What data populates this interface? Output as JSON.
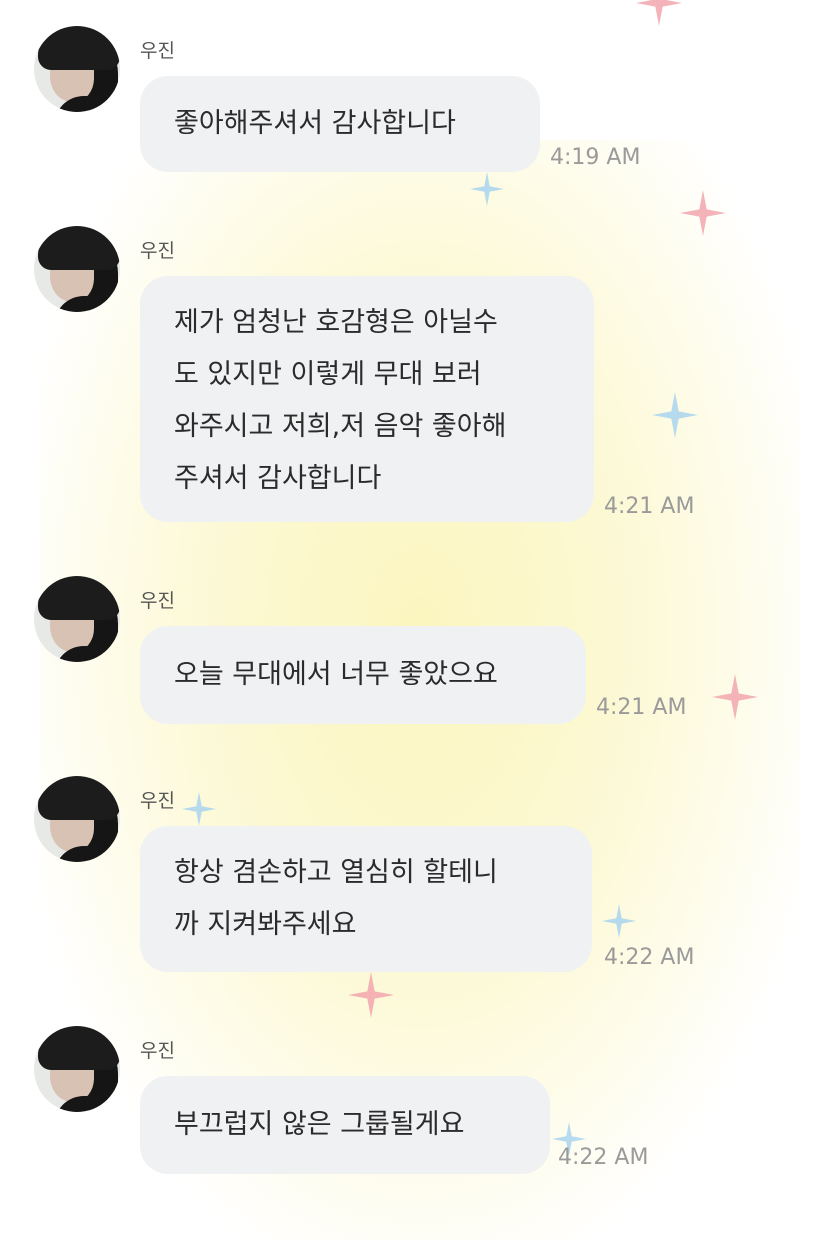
{
  "colors": {
    "bubble_bg": "#f0f1f3",
    "text": "#2b2b2b",
    "name": "#555555",
    "time": "#9a9a9a",
    "sparkle_pink": "#f2a6ad",
    "sparkle_blue": "#a9d3ee",
    "background_glow": "#fbf6bf"
  },
  "messages": [
    {
      "sender": "우진",
      "text": "좋아해주셔서 감사합니다",
      "time": "4:19 AM"
    },
    {
      "sender": "우진",
      "text": "제가 엄청난 호감형은 아닐수\n도 있지만 이렇게 무대 보러\n와주시고 저희,저 음악 좋아해\n주셔서 감사합니다",
      "time": "4:21 AM"
    },
    {
      "sender": "우진",
      "text": "오늘 무대에서 너무 좋았으요",
      "time": "4:21 AM"
    },
    {
      "sender": "우진",
      "text": "항상 겸손하고 열심히 할테니\n까 지켜봐주세요",
      "time": "4:22 AM"
    },
    {
      "sender": "우진",
      "text": "부끄럽지 않은 그룹될게요",
      "time": "4:22 AM"
    }
  ]
}
